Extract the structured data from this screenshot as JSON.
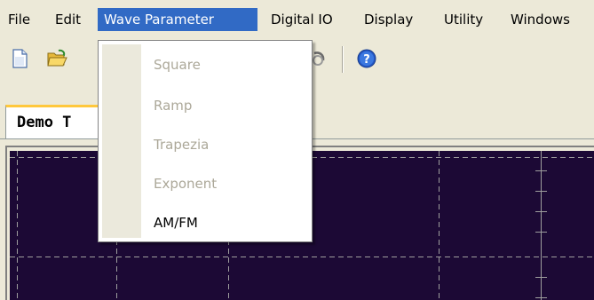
{
  "menubar": {
    "items": [
      {
        "label": "File"
      },
      {
        "label": "Edit"
      },
      {
        "label": "Wave Parameter",
        "active": true
      },
      {
        "label": "Digital IO"
      },
      {
        "label": "Display"
      },
      {
        "label": "Utility"
      },
      {
        "label": "Windows"
      }
    ]
  },
  "toolbar": {
    "icons": [
      "new-document-icon",
      "open-folder-icon",
      "refresh-icon",
      "help-icon"
    ]
  },
  "tabs": [
    {
      "label": "Demo T"
    }
  ],
  "dropdown": {
    "items": [
      {
        "label": "Square",
        "enabled": false
      },
      {
        "label": "Ramp",
        "enabled": false
      },
      {
        "label": "Trapezia",
        "enabled": false
      },
      {
        "label": "Exponent",
        "enabled": false
      },
      {
        "label": "AM/FM",
        "enabled": true
      }
    ]
  },
  "colors": {
    "menu_highlight": "#316ac5",
    "plot_background": "#1c0935",
    "grid_line": "#9e9e9e",
    "disabled_text": "#aca899",
    "tab_accent": "#ffc83c"
  }
}
